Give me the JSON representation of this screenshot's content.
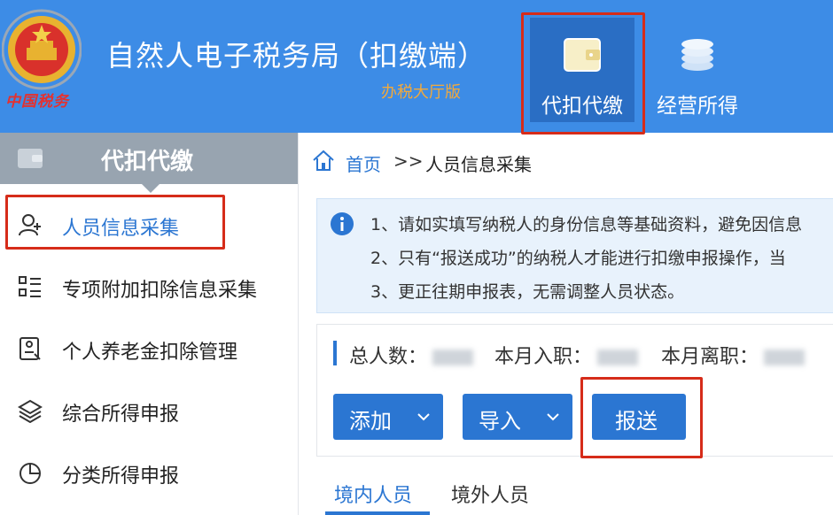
{
  "header": {
    "brand_text": "中国税务",
    "app_title": "自然人电子税务局（扣缴端）",
    "app_subtitle": "办税大厅版",
    "nav": [
      {
        "label": "代扣代缴",
        "icon": "wallet-icon",
        "active": true
      },
      {
        "label": "经营所得",
        "icon": "coins-icon",
        "active": false
      }
    ]
  },
  "sidebar": {
    "title": "代扣代缴",
    "items": [
      {
        "label": "人员信息采集",
        "icon": "person-add-icon",
        "active": true
      },
      {
        "label": "专项附加扣除信息采集",
        "icon": "list-icon",
        "active": false
      },
      {
        "label": "个人养老金扣除管理",
        "icon": "pension-doc-icon",
        "active": false
      },
      {
        "label": "综合所得申报",
        "icon": "layers-icon",
        "active": false
      },
      {
        "label": "分类所得申报",
        "icon": "pie-chart-icon",
        "active": false
      }
    ]
  },
  "breadcrumb": {
    "home": "首页",
    "separator": ">>",
    "current": "人员信息采集"
  },
  "notice": {
    "lines": [
      "1、请如实填写纳税人的身份信息等基础资料，避免因信息",
      "2、只有“报送成功”的纳税人才能进行扣缴申报操作，当",
      "3、更正往期申报表，无需调整人员状态。"
    ]
  },
  "stats": {
    "total_label": "总人数：",
    "joined_label": "本月入职：",
    "left_label": "本月离职："
  },
  "buttons": {
    "add": "添加",
    "import": "导入",
    "report": "报送"
  },
  "tabs": [
    {
      "label": "境内人员",
      "active": true
    },
    {
      "label": "境外人员",
      "active": false
    }
  ],
  "colors": {
    "header_bg": "#3d8ce6",
    "accent": "#2b76d2",
    "highlight": "#d62c1a",
    "sidebar_head": "#98a4b0",
    "subtitle": "#f2a93b"
  }
}
